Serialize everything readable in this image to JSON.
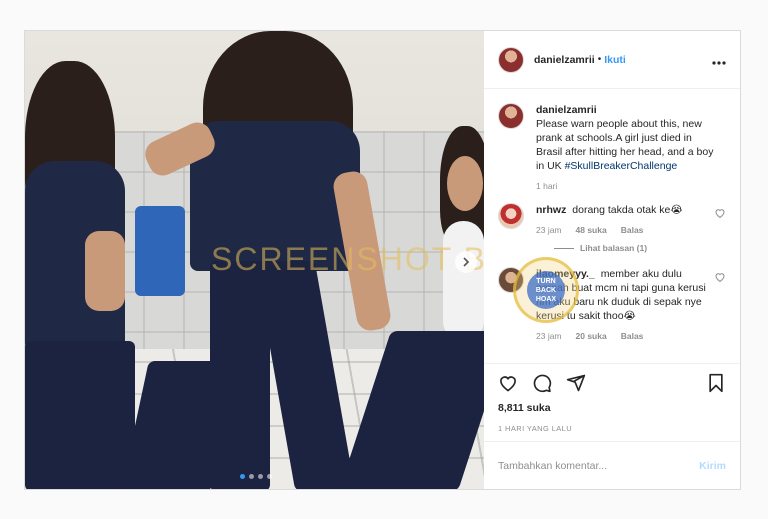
{
  "post": {
    "username": "danielzamrii",
    "separator": "•",
    "follow_label": "Ikuti",
    "more_icon": "more-horizontal-icon",
    "caption": {
      "username": "danielzamrii",
      "text": "Please warn people about this, new prank at schools.A girl just died in Brasil after hitting her head, and a boy in UK ",
      "hashtag": "#SkullBreakerChallenge",
      "time": "1 hari"
    },
    "comments": [
      {
        "username": "nrhwz",
        "text": "dorang takda otak ke😭",
        "time": "23 jam",
        "likes": "48 suka",
        "reply_label": "Balas",
        "view_replies": "Lihat balasan (1)"
      },
      {
        "username": "ilaomeyyy._",
        "text": "member aku dulu pernah buat mcm ni tapi guna kerusi hm aku baru nk duduk di sepak nye kerusi tu sakit thoo😭",
        "time": "23 jam",
        "likes": "20 suka",
        "reply_label": "Balas"
      }
    ],
    "likes_count": "8,811 suka",
    "time_ago": "1 HARI YANG LALU",
    "comment_placeholder": "Tambahkan komentar...",
    "post_label": "Kirim"
  },
  "media": {
    "watermark": "SCREENSHOT BY",
    "stamp_text": "TURN BACK HOAX",
    "carousel_total": 4,
    "carousel_active": 1
  },
  "colors": {
    "accent": "#3897f0",
    "hashtag": "#00376b",
    "muted": "#8e8e8e",
    "post_disabled": "#b3dbff"
  }
}
